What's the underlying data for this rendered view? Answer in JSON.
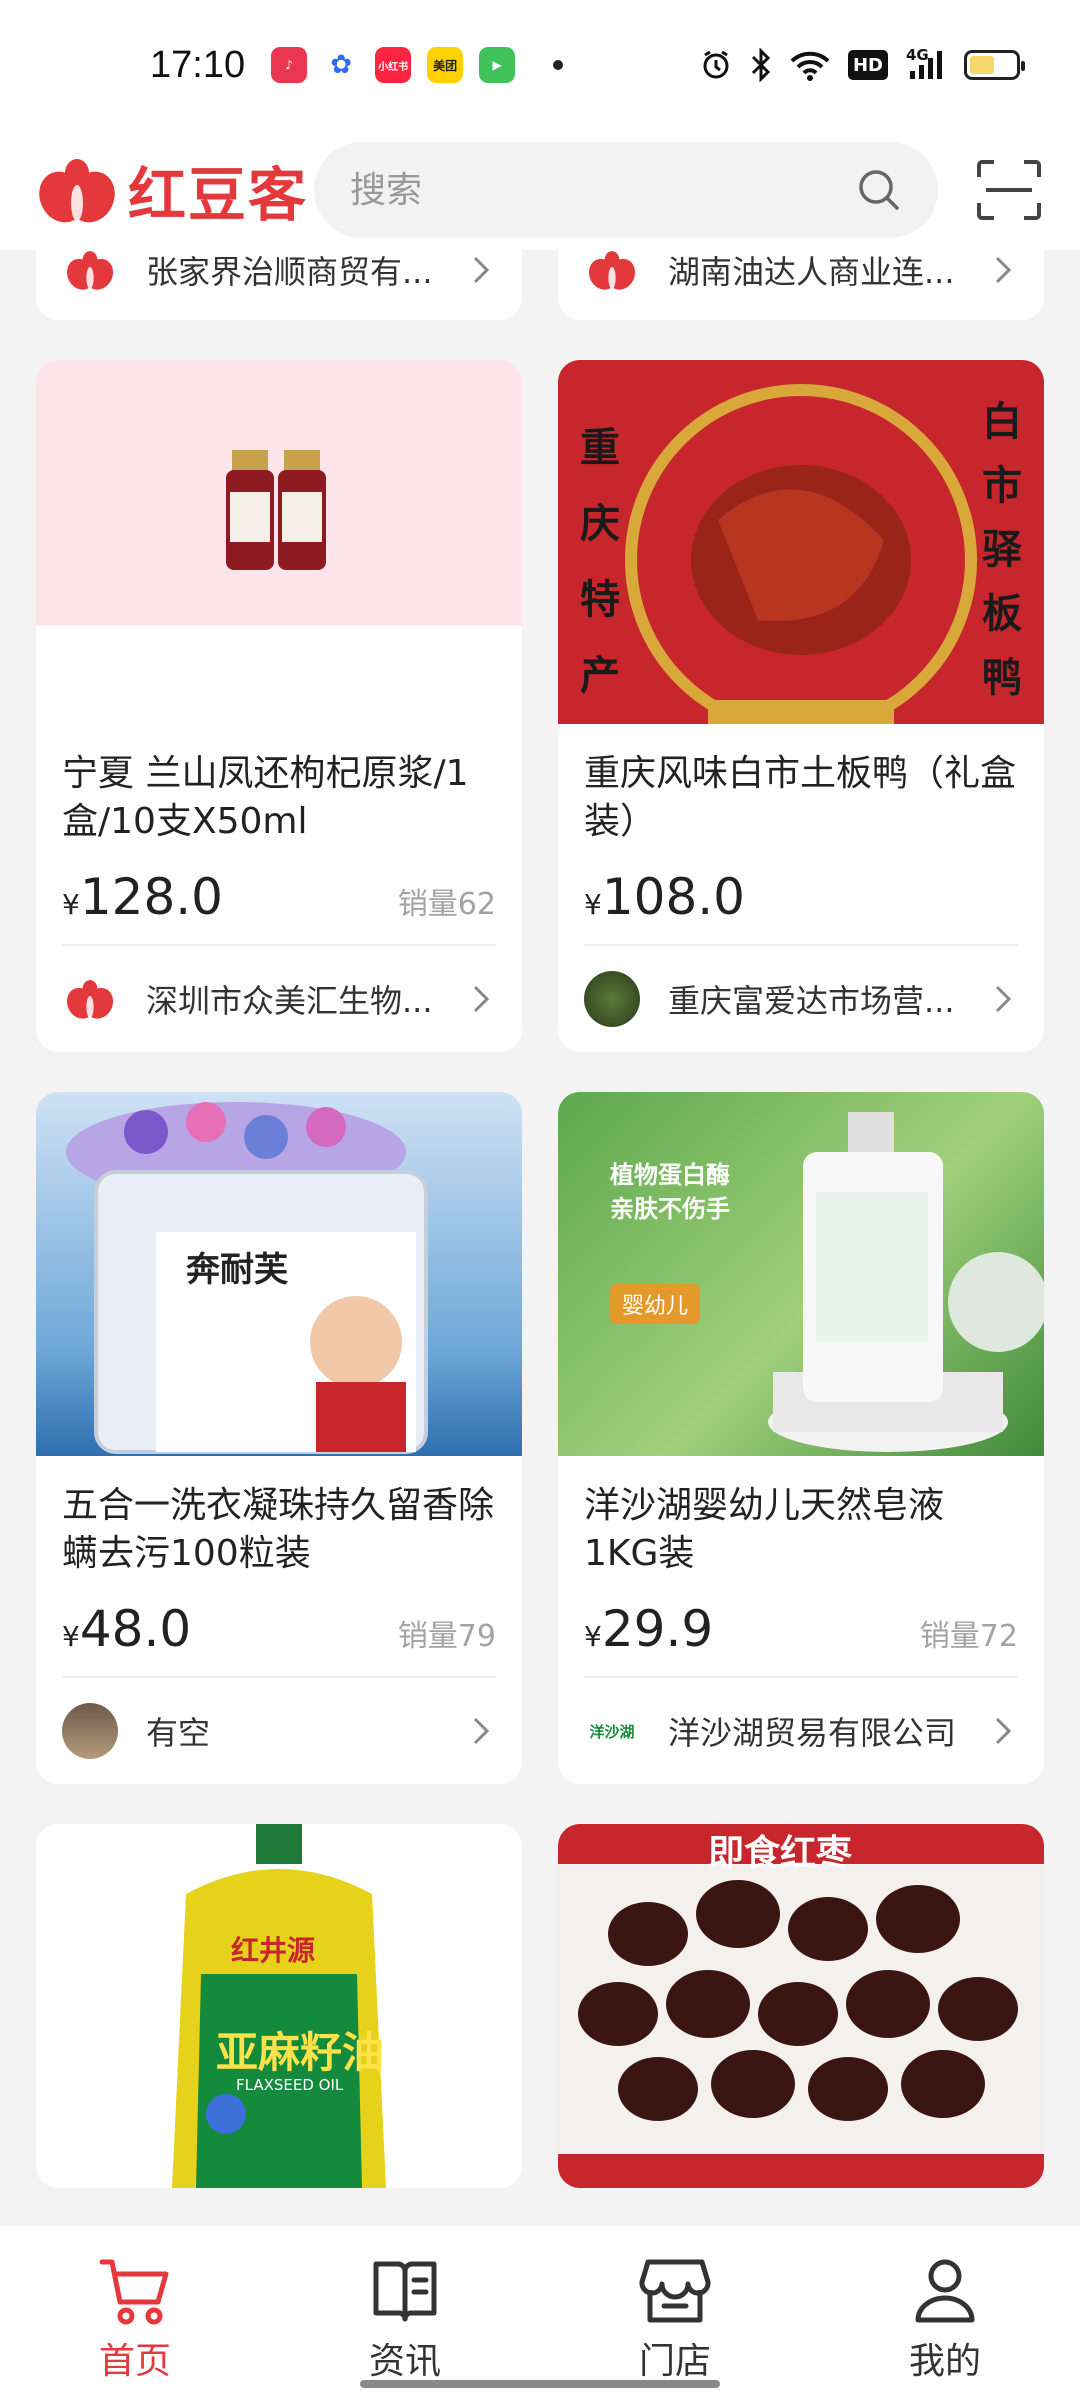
{
  "status_bar": {
    "time": "17:10",
    "apps": [
      {
        "name": "music-app-icon",
        "color": "#e9374f",
        "glyph": "♪"
      },
      {
        "name": "baidu-app-icon",
        "color": "#2f6cf6",
        "glyph": "✿"
      },
      {
        "name": "xiaohongshu-app-icon",
        "color": "#ff2442",
        "glyph": "小红书"
      },
      {
        "name": "meituan-app-icon",
        "color": "#ffd100",
        "glyph": "美团"
      },
      {
        "name": "video-app-icon",
        "color": "#41c35c",
        "glyph": "▶"
      }
    ],
    "network": "4G",
    "hd_label": "HD",
    "battery_level": 0.55
  },
  "header": {
    "logo_text": "红豆客",
    "search_placeholder": "搜索"
  },
  "colors": {
    "brand": "#e4393c",
    "price": "#222222",
    "muted": "#a3a3a3"
  },
  "feed": {
    "top_partial": [
      {
        "shop": "张家界治顺商贸有..."
      },
      {
        "shop": "湖南油达人商业连..."
      }
    ],
    "products": [
      {
        "title": "宁夏 兰山凤还枸杞原浆/1盒/10支X50ml",
        "price_symbol": "¥",
        "price": "128.0",
        "sales": "销量62",
        "shop": "深圳市众美汇生物..."
      },
      {
        "title": "重庆风味白市土板鸭（礼盒装）",
        "price_symbol": "¥",
        "price": "108.0",
        "sales": "",
        "shop": "重庆富爱达市场营...",
        "image_text_left": [
          "重",
          "庆",
          "特",
          "产"
        ],
        "image_text_right": [
          "白",
          "市",
          "驿",
          "板",
          "鸭"
        ]
      },
      {
        "title": "五合一洗衣凝珠持久留香除螨去污100粒装",
        "price_symbol": "¥",
        "price": "48.0",
        "sales": "销量79",
        "shop": "有空",
        "image_brand": "奔耐芙"
      },
      {
        "title": "洋沙湖婴幼儿天然皂液1KG装",
        "price_symbol": "¥",
        "price": "29.9",
        "sales": "销量72",
        "shop": "洋沙湖贸易有限公司",
        "image_text": [
          "植物蛋白酶",
          "亲肤不伤手"
        ],
        "image_tag": "婴幼儿",
        "shop_logo_text": "洋沙湖"
      },
      {
        "image_brand": "红井源",
        "image_text": "亚麻籽油",
        "image_sub": "FLAXSEED OIL"
      },
      {
        "image_text": "即食红枣"
      }
    ]
  },
  "bottom_nav": [
    {
      "label": "首页",
      "icon": "cart-icon",
      "active": true
    },
    {
      "label": "资讯",
      "icon": "book-icon",
      "active": false
    },
    {
      "label": "门店",
      "icon": "store-icon",
      "active": false
    },
    {
      "label": "我的",
      "icon": "user-icon",
      "active": false
    }
  ]
}
